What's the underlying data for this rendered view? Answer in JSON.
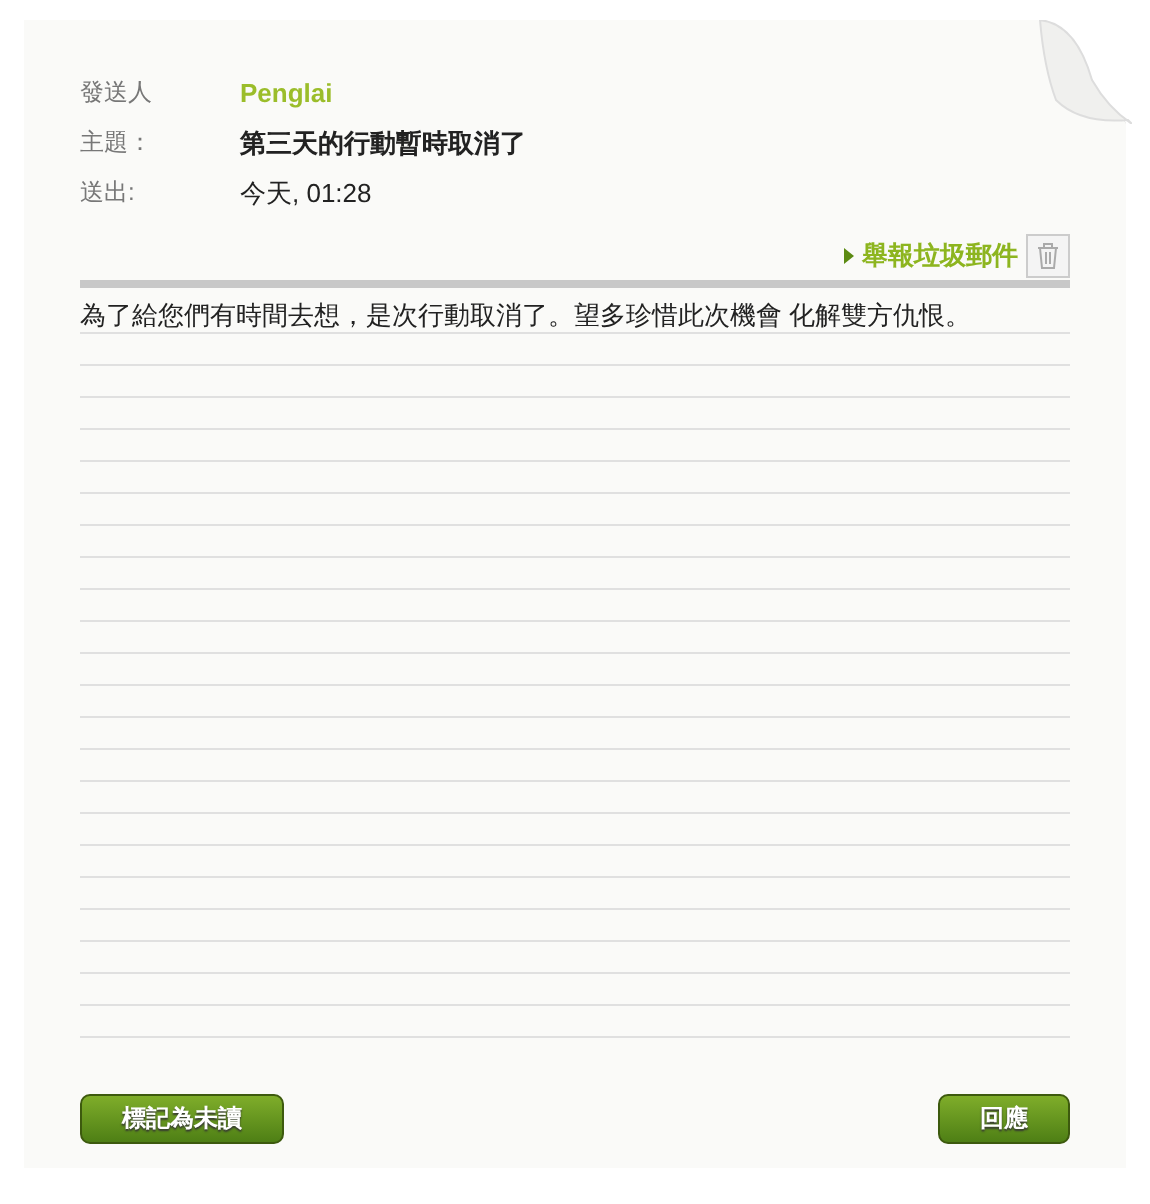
{
  "header": [
    {
      "label": "發送人",
      "value": "Penglai",
      "kind": "sender"
    },
    {
      "label": "主題：",
      "value": "第三天的行動暫時取消了",
      "kind": "subject"
    },
    {
      "label": "送出:",
      "value": "今天, 01:28",
      "kind": "date"
    }
  ],
  "report_link": "舉報垃圾郵件",
  "body": "為了給您們有時間去想，是次行動取消了。望多珍惜此次機會 化解雙方仇恨。",
  "buttons": [
    "標記為未讀",
    "回應"
  ]
}
